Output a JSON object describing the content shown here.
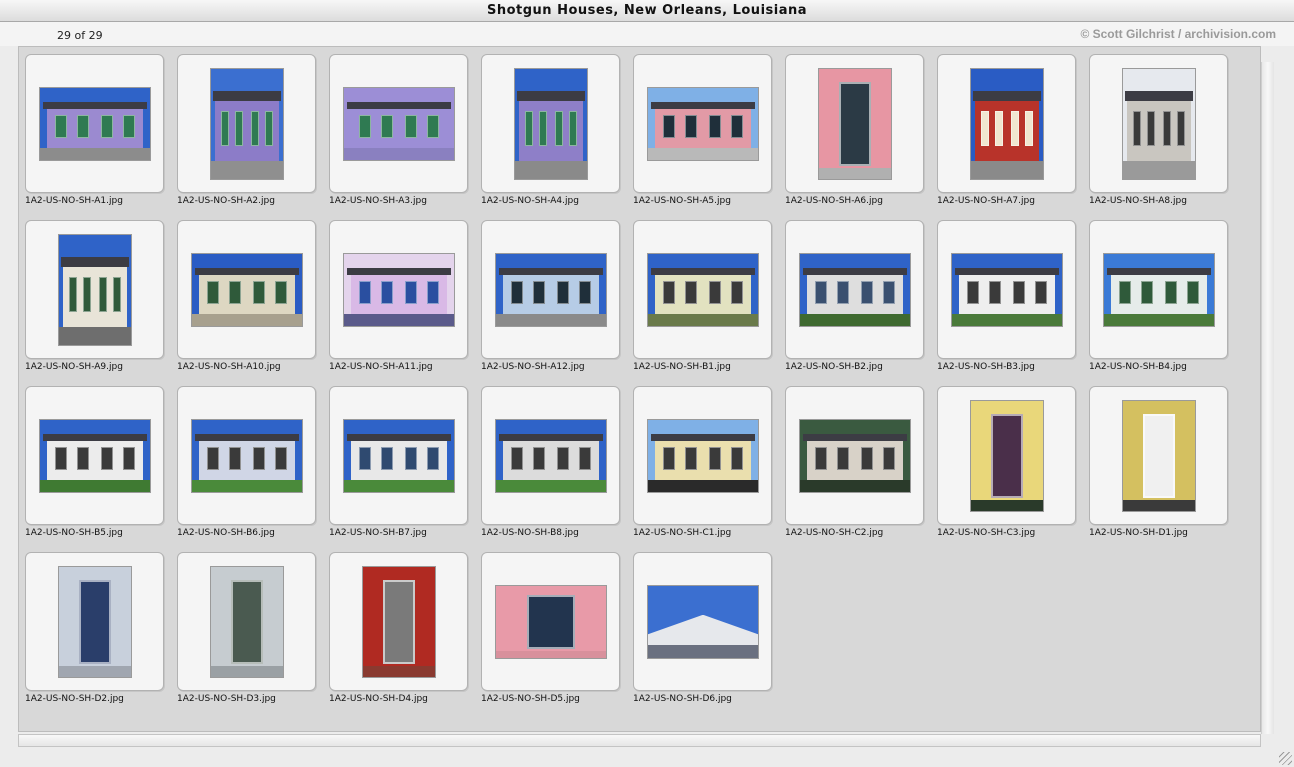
{
  "window": {
    "title": "Shotgun Houses, New Orleans, Louisiana",
    "counter": "29 of 29",
    "credit": "© Scott Gilchrist / archivision.com"
  },
  "gallery": {
    "items": [
      {
        "filename": "1A2-US-NO-SH-A1.jpg",
        "orientation": "landscape",
        "kind": "house",
        "wall": "#9b8ad0",
        "trim": "#2f7a52",
        "sky": "#2f63c8",
        "ground": "#8c8c8c"
      },
      {
        "filename": "1A2-US-NO-SH-A2.jpg",
        "orientation": "portrait",
        "kind": "house",
        "wall": "#8c7cc8",
        "trim": "#2f7a52",
        "sky": "#3b6fd0",
        "ground": "#8f8f8f"
      },
      {
        "filename": "1A2-US-NO-SH-A3.jpg",
        "orientation": "landscape",
        "kind": "house",
        "wall": "#9c8ed6",
        "trim": "#2f7a52",
        "sky": "#9c8ed6",
        "ground": "#8a80c0"
      },
      {
        "filename": "1A2-US-NO-SH-A4.jpg",
        "orientation": "portrait",
        "kind": "house",
        "wall": "#8e7fc8",
        "trim": "#2f7a52",
        "sky": "#2f63c8",
        "ground": "#8a8a8a"
      },
      {
        "filename": "1A2-US-NO-SH-A5.jpg",
        "orientation": "landscape",
        "kind": "house",
        "wall": "#e29aa6",
        "trim": "#1f2f3a",
        "sky": "#7fb0e6",
        "ground": "#b9b9b9"
      },
      {
        "filename": "1A2-US-NO-SH-A6.jpg",
        "orientation": "portrait",
        "kind": "door",
        "wall": "#e796a3",
        "trim": "#2b3a45",
        "sky": "#e796a3",
        "ground": "#b0b0b0"
      },
      {
        "filename": "1A2-US-NO-SH-A7.jpg",
        "orientation": "portrait",
        "kind": "house",
        "wall": "#b8332a",
        "trim": "#f0e6d0",
        "sky": "#2a5cc4",
        "ground": "#8a8a8a"
      },
      {
        "filename": "1A2-US-NO-SH-A8.jpg",
        "orientation": "portrait",
        "kind": "house",
        "wall": "#c9c6c0",
        "trim": "#3a3a3a",
        "sky": "#e6e9ee",
        "ground": "#9a9a9a"
      },
      {
        "filename": "1A2-US-NO-SH-A9.jpg",
        "orientation": "portrait",
        "kind": "house",
        "wall": "#e8e4d8",
        "trim": "#2f5a3a",
        "sky": "#2f63c8",
        "ground": "#6e6e6e"
      },
      {
        "filename": "1A2-US-NO-SH-A10.jpg",
        "orientation": "landscape",
        "kind": "house",
        "wall": "#ddd7c2",
        "trim": "#2f5a3a",
        "sky": "#2a5cc4",
        "ground": "#a7a08e"
      },
      {
        "filename": "1A2-US-NO-SH-A11.jpg",
        "orientation": "landscape",
        "kind": "house",
        "wall": "#d9b9e6",
        "trim": "#2a4fa0",
        "sky": "#e4d4ec",
        "ground": "#5a5a8a"
      },
      {
        "filename": "1A2-US-NO-SH-A12.jpg",
        "orientation": "landscape",
        "kind": "house",
        "wall": "#b6cce6",
        "trim": "#1f2f3a",
        "sky": "#2f63c8",
        "ground": "#8a8a8a"
      },
      {
        "filename": "1A2-US-NO-SH-B1.jpg",
        "orientation": "landscape",
        "kind": "house",
        "wall": "#e2e2c0",
        "trim": "#3a3a3a",
        "sky": "#2f63c8",
        "ground": "#6a7a4a"
      },
      {
        "filename": "1A2-US-NO-SH-B2.jpg",
        "orientation": "landscape",
        "kind": "house",
        "wall": "#dedede",
        "trim": "#3a5070",
        "sky": "#2f63c8",
        "ground": "#3f6a30"
      },
      {
        "filename": "1A2-US-NO-SH-B3.jpg",
        "orientation": "landscape",
        "kind": "house",
        "wall": "#eeeeee",
        "trim": "#3a3a3a",
        "sky": "#2f63c8",
        "ground": "#4a7a3a"
      },
      {
        "filename": "1A2-US-NO-SH-B4.jpg",
        "orientation": "landscape",
        "kind": "house",
        "wall": "#e6ecea",
        "trim": "#2f5a3a",
        "sky": "#3b7ad6",
        "ground": "#4a7a3a"
      },
      {
        "filename": "1A2-US-NO-SH-B5.jpg",
        "orientation": "landscape",
        "kind": "house",
        "wall": "#ececec",
        "trim": "#3a3a3a",
        "sky": "#2f63c8",
        "ground": "#3f7a32"
      },
      {
        "filename": "1A2-US-NO-SH-B6.jpg",
        "orientation": "landscape",
        "kind": "house",
        "wall": "#d0d6e6",
        "trim": "#3a3a3a",
        "sky": "#2f63c8",
        "ground": "#4a8a3a"
      },
      {
        "filename": "1A2-US-NO-SH-B7.jpg",
        "orientation": "landscape",
        "kind": "house",
        "wall": "#e8e8e8",
        "trim": "#2f4a70",
        "sky": "#2f63c8",
        "ground": "#4a8a3a"
      },
      {
        "filename": "1A2-US-NO-SH-B8.jpg",
        "orientation": "landscape",
        "kind": "house",
        "wall": "#dcdcdc",
        "trim": "#3a3a3a",
        "sky": "#2f63c8",
        "ground": "#4a8a3a"
      },
      {
        "filename": "1A2-US-NO-SH-C1.jpg",
        "orientation": "landscape",
        "kind": "house",
        "wall": "#eadfae",
        "trim": "#3a3a3a",
        "sky": "#7fb0e6",
        "ground": "#2a2a2a"
      },
      {
        "filename": "1A2-US-NO-SH-C2.jpg",
        "orientation": "landscape",
        "kind": "house",
        "wall": "#d8d2c8",
        "trim": "#3a3a3a",
        "sky": "#3a5a40",
        "ground": "#2a3a2a"
      },
      {
        "filename": "1A2-US-NO-SH-C3.jpg",
        "orientation": "portrait",
        "kind": "door",
        "wall": "#e9d77a",
        "trim": "#4a2f4a",
        "sky": "#e9d77a",
        "ground": "#2a3a2a"
      },
      {
        "filename": "1A2-US-NO-SH-D1.jpg",
        "orientation": "portrait",
        "kind": "door",
        "wall": "#d4c060",
        "trim": "#f0f0f0",
        "sky": "#2a2a2a",
        "ground": "#3a3a3a"
      },
      {
        "filename": "1A2-US-NO-SH-D2.jpg",
        "orientation": "portrait",
        "kind": "door",
        "wall": "#c8d0dc",
        "trim": "#2a3e6a",
        "sky": "#c8d0dc",
        "ground": "#a0a6b0"
      },
      {
        "filename": "1A2-US-NO-SH-D3.jpg",
        "orientation": "portrait",
        "kind": "door",
        "wall": "#c6ccd0",
        "trim": "#4a5a50",
        "sky": "#c6ccd0",
        "ground": "#9aa0a4"
      },
      {
        "filename": "1A2-US-NO-SH-D4.jpg",
        "orientation": "portrait",
        "kind": "door",
        "wall": "#b02a22",
        "trim": "#7a7a7a",
        "sky": "#b02a22",
        "ground": "#8a3a30"
      },
      {
        "filename": "1A2-US-NO-SH-D5.jpg",
        "orientation": "landscape",
        "kind": "door",
        "wall": "#e89aa8",
        "trim": "#22344e",
        "sky": "#e89aa8",
        "ground": "#d8909c"
      },
      {
        "filename": "1A2-US-NO-SH-D6.jpg",
        "orientation": "landscape",
        "kind": "gable",
        "wall": "#e6e8ec",
        "trim": "#2f5aa0",
        "sky": "#3b6fd0",
        "ground": "#6a7080"
      }
    ]
  }
}
